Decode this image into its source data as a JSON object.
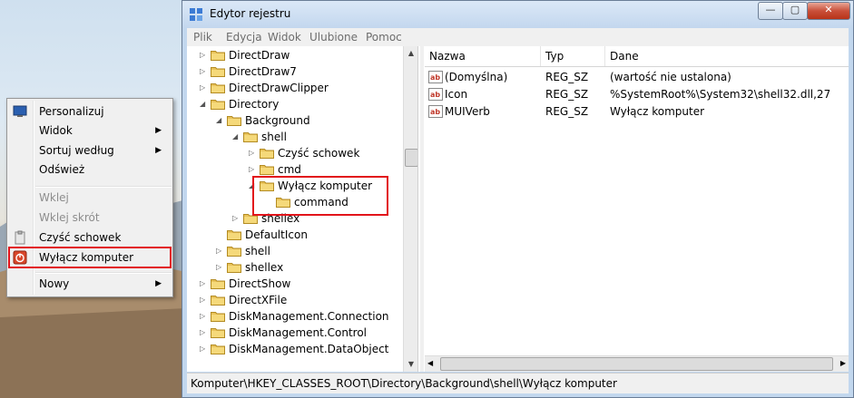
{
  "context_menu": {
    "items": [
      {
        "label": "Personalizuj",
        "icon": "monitor-icon"
      },
      {
        "label": "Widok",
        "submenu": true
      },
      {
        "label": "Sortuj według",
        "submenu": true
      },
      {
        "label": "Odśwież"
      },
      {
        "label": "Wklej",
        "disabled": true
      },
      {
        "label": "Wklej skrót",
        "disabled": true
      },
      {
        "label": "Czyść schowek",
        "icon": "clipboard-icon"
      },
      {
        "label": "Wyłącz komputer",
        "icon": "power-icon",
        "highlighted": true
      },
      {
        "label": "Nowy",
        "submenu": true
      }
    ],
    "arrow": "▶"
  },
  "window": {
    "title": "Edytor rejestru",
    "buttons": {
      "minimize": "—",
      "maximize": "▢",
      "close": "✕"
    },
    "menu": [
      "Plik",
      "Edycja",
      "Widok",
      "Ulubione",
      "Pomoc"
    ]
  },
  "tree": [
    {
      "label": "DirectDraw",
      "exp": "▷"
    },
    {
      "label": "DirectDraw7",
      "exp": "▷"
    },
    {
      "label": "DirectDrawClipper",
      "exp": "▷"
    },
    {
      "label": "Directory",
      "exp": "◢"
    },
    {
      "label": "Background",
      "exp": "◢"
    },
    {
      "label": "shell",
      "exp": "◢"
    },
    {
      "label": "Czyść schowek",
      "exp": "▷"
    },
    {
      "label": "cmd",
      "exp": "▷"
    },
    {
      "label": "Wyłącz komputer",
      "exp": "◢"
    },
    {
      "label": "command",
      "exp": ""
    },
    {
      "label": "shellex",
      "exp": "▷"
    },
    {
      "label": "DefaultIcon",
      "exp": ""
    },
    {
      "label": "shell",
      "exp": "▷"
    },
    {
      "label": "shellex",
      "exp": "▷"
    },
    {
      "label": "DirectShow",
      "exp": "▷"
    },
    {
      "label": "DirectXFile",
      "exp": "▷"
    },
    {
      "label": "DiskManagement.Connection",
      "exp": "▷"
    },
    {
      "label": "DiskManagement.Control",
      "exp": "▷"
    },
    {
      "label": "DiskManagement.DataObject",
      "exp": "▷"
    }
  ],
  "list": {
    "columns": [
      "Nazwa",
      "Typ",
      "Dane"
    ],
    "rows": [
      {
        "name": "(Domyślna)",
        "type": "REG_SZ",
        "data": "(wartość nie ustalona)"
      },
      {
        "name": "Icon",
        "type": "REG_SZ",
        "data": "%SystemRoot%\\System32\\shell32.dll,27"
      },
      {
        "name": "MUIVerb",
        "type": "REG_SZ",
        "data": "Wyłącz komputer"
      }
    ],
    "value_icon": "ab"
  },
  "status": "Komputer\\HKEY_CLASSES_ROOT\\Directory\\Background\\shell\\Wyłącz komputer",
  "colors": {
    "highlight_border": "#e2141b",
    "folder": "#e8c25a"
  }
}
